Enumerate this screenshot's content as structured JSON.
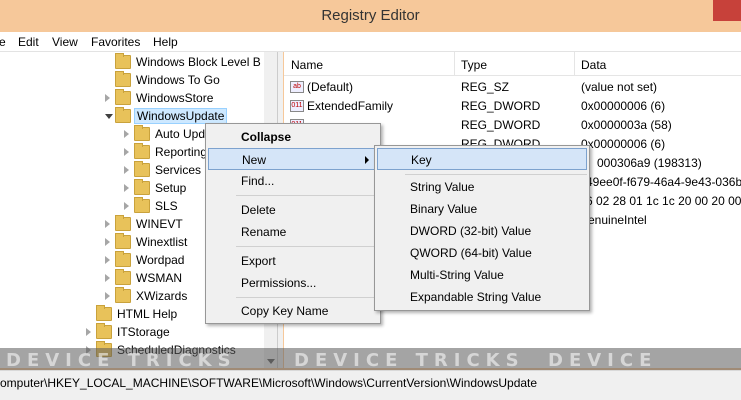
{
  "window": {
    "title": "Registry Editor"
  },
  "menu": [
    "e",
    "Edit",
    "View",
    "Favorites",
    "Help"
  ],
  "tree": {
    "items": [
      {
        "label": "Windows Block Level B"
      },
      {
        "label": "Windows To Go"
      },
      {
        "label": "WindowsStore"
      },
      {
        "label": "WindowsUpdate"
      },
      {
        "label": "Auto Upd"
      },
      {
        "label": "Reporting"
      },
      {
        "label": "Services"
      },
      {
        "label": "Setup"
      },
      {
        "label": "SLS"
      },
      {
        "label": "WINEVT"
      },
      {
        "label": "Winextlist"
      },
      {
        "label": "Wordpad"
      },
      {
        "label": "WSMAN"
      },
      {
        "label": "XWizards"
      },
      {
        "label": "HTML Help"
      },
      {
        "label": "ITStorage"
      },
      {
        "label": "ScheduledDiagnostics"
      }
    ]
  },
  "list": {
    "headers": {
      "name": "Name",
      "type": "Type",
      "data": "Data"
    },
    "rows": [
      {
        "icon": "ab",
        "name": "(Default)",
        "type": "REG_SZ",
        "data": "(value not set)"
      },
      {
        "icon": "011",
        "name": "ExtendedFamily",
        "type": "REG_DWORD",
        "data": "0x00000006 (6)"
      },
      {
        "icon": "011",
        "name": "",
        "type": "REG_DWORD",
        "data": "0x0000003a (58)"
      },
      {
        "icon": "011",
        "name": "",
        "type": "REG_DWORD",
        "data": "0x00000006 (6)"
      },
      {
        "icon": "",
        "name": "",
        "type": "",
        "data": "000306a9 (198313)"
      },
      {
        "icon": "",
        "name": "",
        "type": "",
        "data": "49ee0f-f679-46a4-9e43-036bf"
      },
      {
        "icon": "",
        "name": "",
        "type": "",
        "data": "6 02 28 01 1c 1c 20 00 20 00 20"
      },
      {
        "icon": "",
        "name": "",
        "type": "",
        "data": "enuineIntel"
      }
    ]
  },
  "context_menu": {
    "items": [
      "Collapse",
      "New",
      "Find...",
      "Delete",
      "Rename",
      "Export",
      "Permissions...",
      "Copy Key Name"
    ]
  },
  "new_submenu": {
    "items": [
      "Key",
      "String Value",
      "Binary Value",
      "DWORD (32-bit) Value",
      "QWORD (64-bit) Value",
      "Multi-String Value",
      "Expandable String Value"
    ]
  },
  "status": {
    "path": "omputer\\HKEY_LOCAL_MACHINE\\SOFTWARE\\Microsoft\\Windows\\CurrentVersion\\WindowsUpdate"
  },
  "watermark": {
    "text": "DEVICE TRICKS"
  },
  "colors": {
    "title_bg": "#f6c89a",
    "close": "#c7413a",
    "highlight": "#d5e5f8",
    "selection": "#cde8ff"
  }
}
